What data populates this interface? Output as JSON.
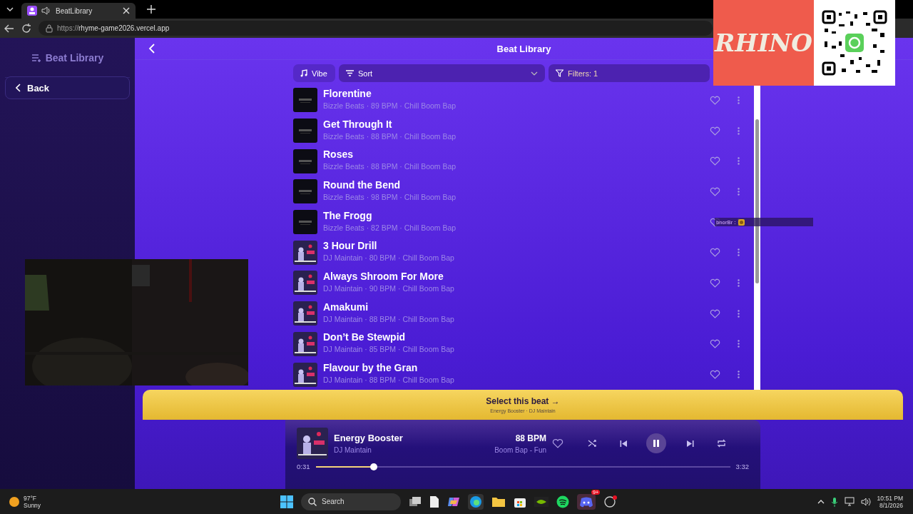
{
  "browser": {
    "tab_title": "BeatLibrary",
    "url_scheme": "https://",
    "url_host": "rhyme-game2026.vercel.app"
  },
  "sidebar": {
    "title": "Beat Library",
    "back": "Back"
  },
  "header": {
    "title": "Beat Library"
  },
  "toolbar": {
    "vibe": "Vibe",
    "sort": "Sort",
    "filters": "Filters: 1"
  },
  "beats": [
    {
      "title": "Florentine",
      "meta": "Bizzle Beats · 89 BPM · Chill Boom Bap"
    },
    {
      "title": "Get Through It",
      "meta": "Bizzle Beats · 88 BPM · Chill Boom Bap"
    },
    {
      "title": "Roses",
      "meta": "Bizzle Beats · 88 BPM · Chill Boom Bap"
    },
    {
      "title": "Round the Bend",
      "meta": "Bizzle Beats · 98 BPM · Chill Boom Bap"
    },
    {
      "title": "The Frogg",
      "meta": "Bizzle Beats · 82 BPM · Chill Boom Bap"
    },
    {
      "title": "3 Hour Drill",
      "meta": "DJ Maintain · 80 BPM · Chill Boom Bap"
    },
    {
      "title": "Always Shroom For More",
      "meta": "DJ Maintain · 90 BPM · Chill Boom Bap"
    },
    {
      "title": "Amakumi",
      "meta": "DJ Maintain · 88 BPM · Chill Boom Bap"
    },
    {
      "title": "Don’t Be Stewpid",
      "meta": "DJ Maintain · 85 BPM · Chill Boom Bap"
    },
    {
      "title": "Flavour by the Gran",
      "meta": "DJ Maintain · 88 BPM · Chill Boom Bap"
    }
  ],
  "select": {
    "label": "Select this beat →",
    "sub": "Energy Booster · DJ Maintain"
  },
  "player": {
    "title": "Energy Booster",
    "artist": "DJ Maintain",
    "bpm": "88 BPM",
    "tags": "Boom Bap - Fun",
    "elapsed": "0:31",
    "duration": "3:32",
    "level": 0.14,
    "playing": true
  },
  "overlay": {
    "logo": "RHINO",
    "chat_user": "bnorBr :"
  },
  "taskbar": {
    "temp": "97°F",
    "weather": "Sunny",
    "search": "Search",
    "badge": "9+",
    "time": "10:51 PM",
    "date": "8/1/2026"
  }
}
